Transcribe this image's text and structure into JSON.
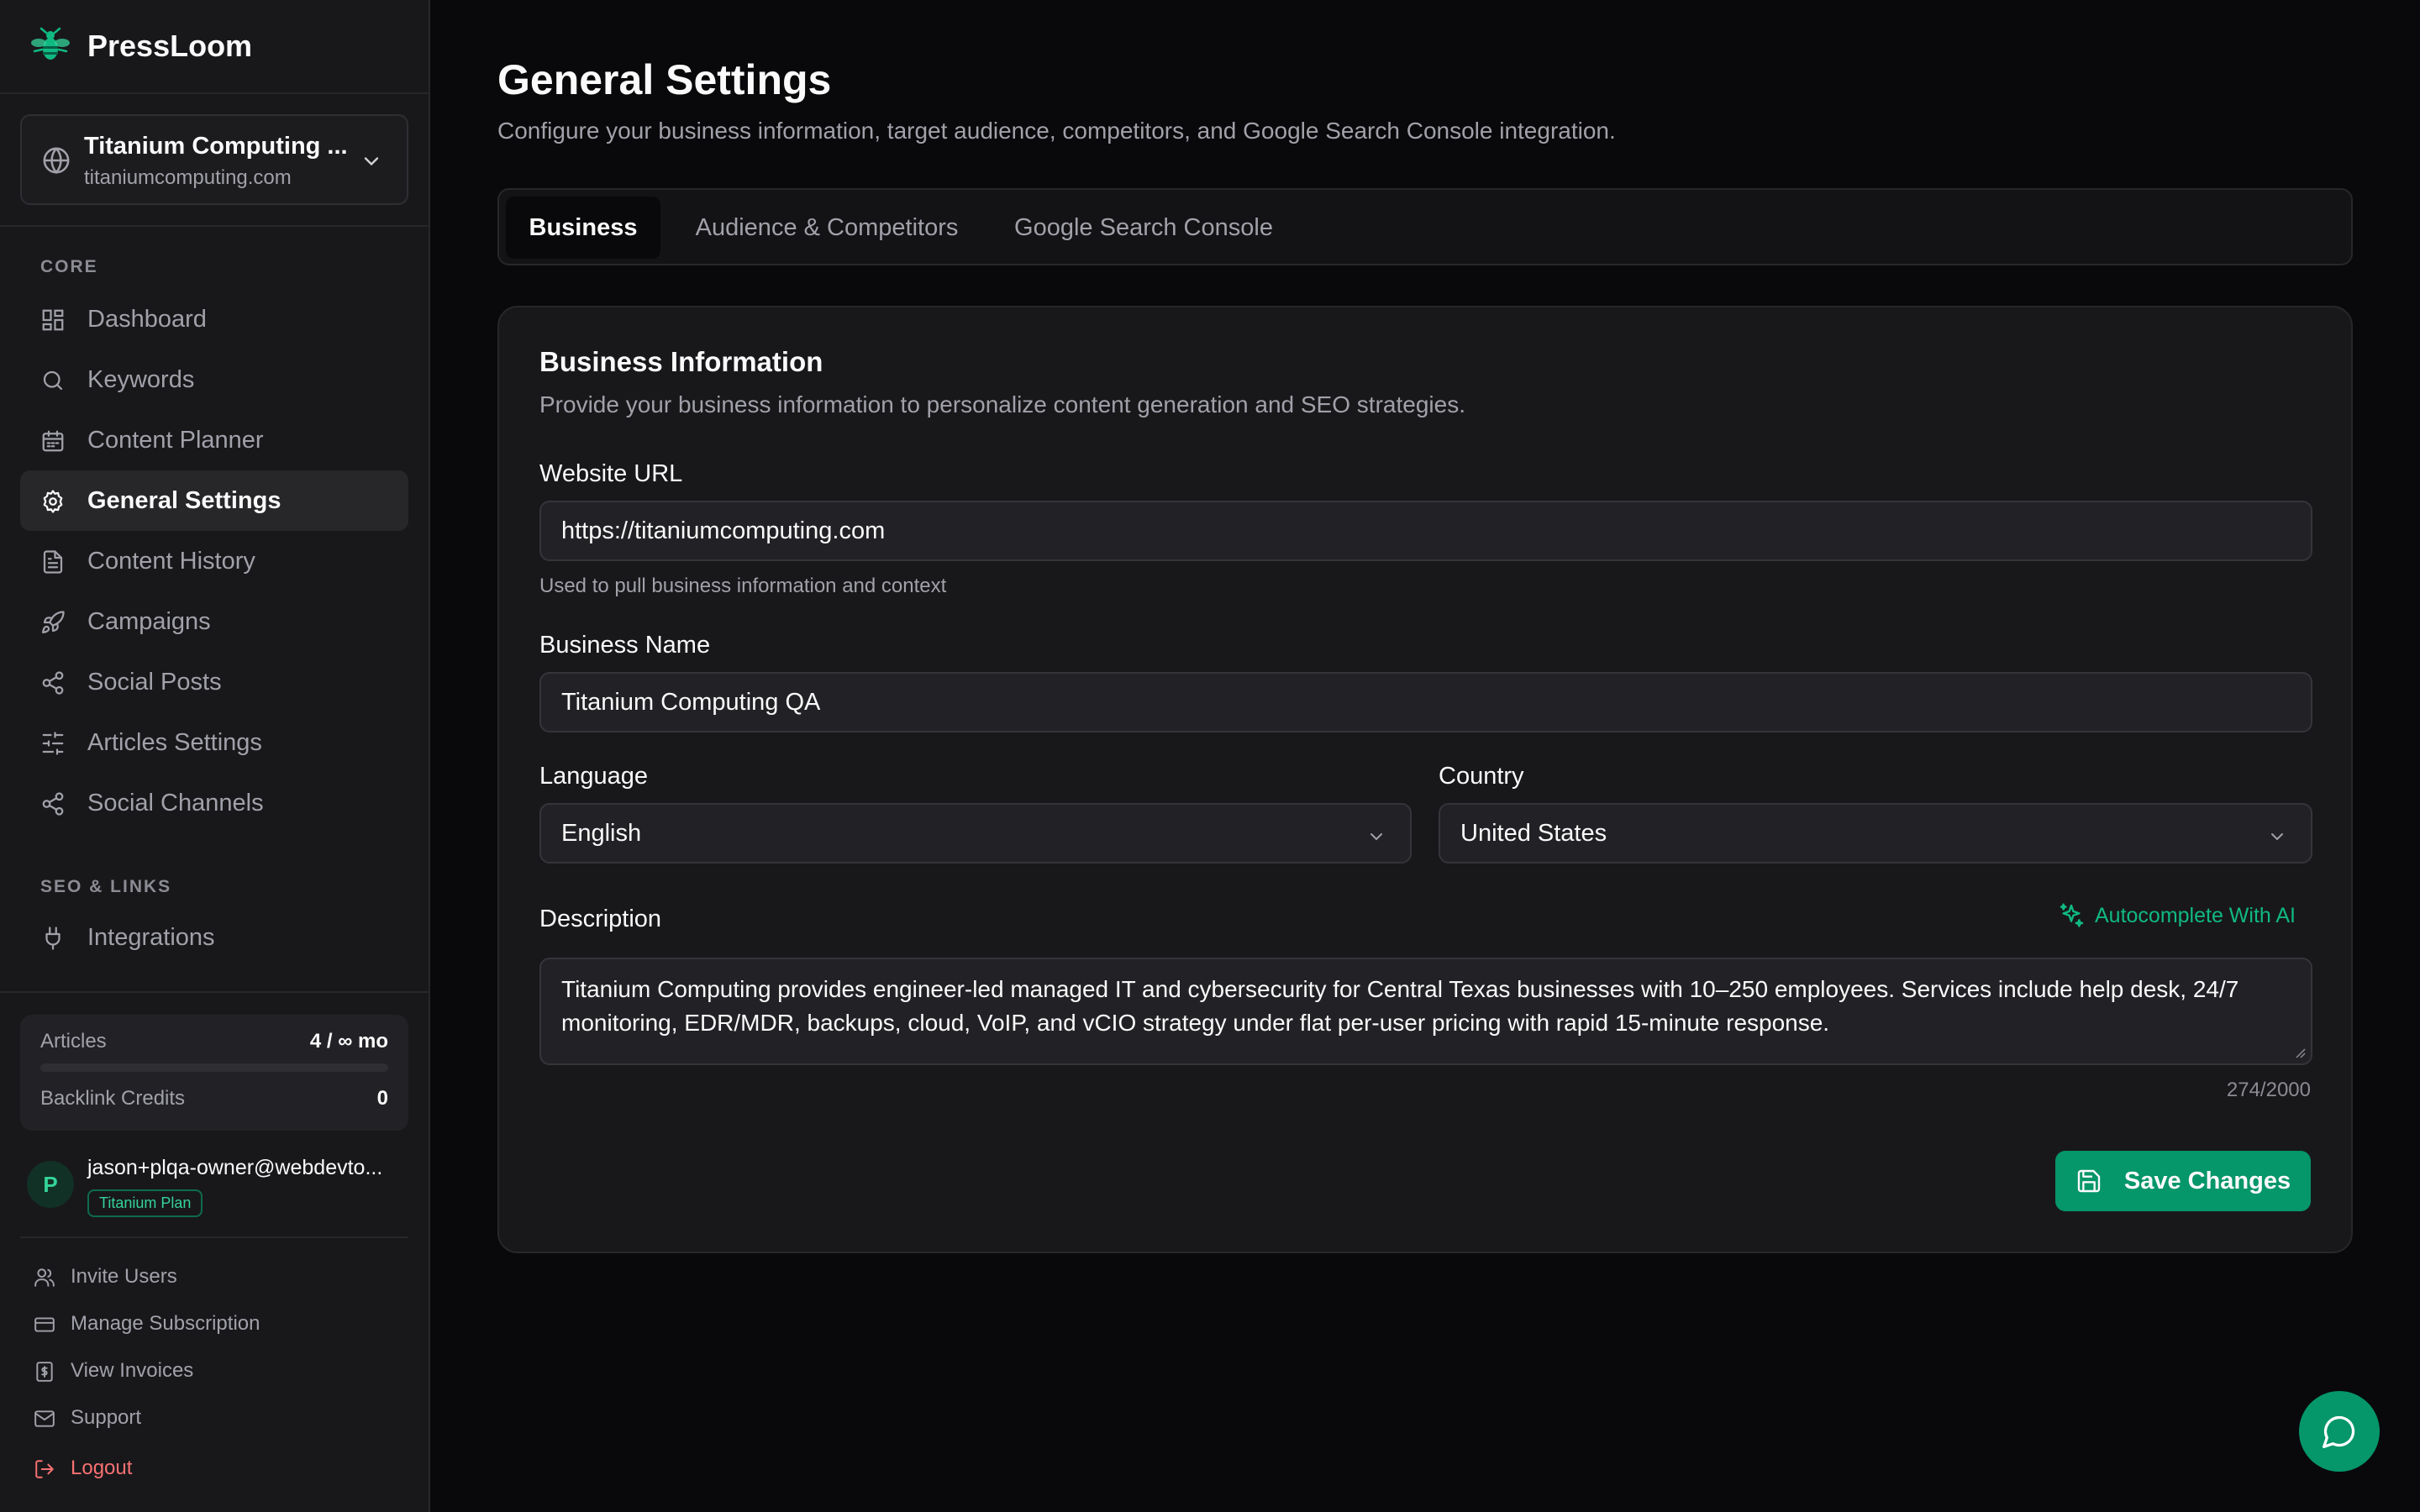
{
  "brand": {
    "name": "PressLoom"
  },
  "site_selector": {
    "name": "Titanium Computing ...",
    "domain": "titaniumcomputing.com"
  },
  "sidebar": {
    "sections": [
      {
        "label": "CORE"
      },
      {
        "label": "SEO & LINKS"
      }
    ],
    "items": [
      {
        "label": "Dashboard",
        "icon": "dashboard-icon"
      },
      {
        "label": "Keywords",
        "icon": "search-icon"
      },
      {
        "label": "Content Planner",
        "icon": "calendar-icon"
      },
      {
        "label": "General Settings",
        "icon": "gear-icon",
        "active": true
      },
      {
        "label": "Content History",
        "icon": "document-icon"
      },
      {
        "label": "Campaigns",
        "icon": "rocket-icon"
      },
      {
        "label": "Social Posts",
        "icon": "share-icon"
      },
      {
        "label": "Articles Settings",
        "icon": "sliders-icon"
      },
      {
        "label": "Social Channels",
        "icon": "share-icon"
      },
      {
        "label": "Integrations",
        "icon": "plug-icon"
      }
    ],
    "usage": {
      "articles_label": "Articles",
      "articles_value": "4 / ∞ mo",
      "articles_progress": 0,
      "backlink_label": "Backlink Credits",
      "backlink_value": "0"
    },
    "user": {
      "initial": "P",
      "email": "jason+plqa-owner@webdevto...",
      "plan": "Titanium Plan"
    },
    "footer": [
      {
        "label": "Invite Users",
        "icon": "users-icon"
      },
      {
        "label": "Manage Subscription",
        "icon": "credit-card-icon"
      },
      {
        "label": "View Invoices",
        "icon": "invoice-icon"
      },
      {
        "label": "Support",
        "icon": "mail-icon"
      },
      {
        "label": "Logout",
        "icon": "logout-icon"
      }
    ]
  },
  "page": {
    "title": "General Settings",
    "subtitle": "Configure your business information, target audience, competitors, and Google Search Console integration."
  },
  "tabs": [
    {
      "label": "Business",
      "active": true
    },
    {
      "label": "Audience & Competitors"
    },
    {
      "label": "Google Search Console"
    }
  ],
  "card": {
    "title": "Business Information",
    "subtitle": "Provide your business information to personalize content generation and SEO strategies.",
    "website_url": {
      "label": "Website URL",
      "value": "https://titaniumcomputing.com",
      "hint": "Used to pull business information and context"
    },
    "business_name": {
      "label": "Business Name",
      "value": "Titanium Computing QA"
    },
    "language": {
      "label": "Language",
      "value": "English"
    },
    "country": {
      "label": "Country",
      "value": "United States"
    },
    "description": {
      "label": "Description",
      "autocomplete_label": "Autocomplete With AI",
      "value": "Titanium Computing provides engineer-led managed IT and cybersecurity for Central Texas businesses with 10–250 employees. Services include help desk, 24/7 monitoring, EDR/MDR, backups, cloud, VoIP, and vCIO strategy under flat per-user pricing with rapid 15-minute response.",
      "counter": "274/2000"
    },
    "save_label": "Save Changes"
  },
  "colors": {
    "accent": "#059669",
    "accent_text": "#10b981",
    "background": "#09090b",
    "sidebar": "#18181b",
    "logout": "#f87171"
  }
}
